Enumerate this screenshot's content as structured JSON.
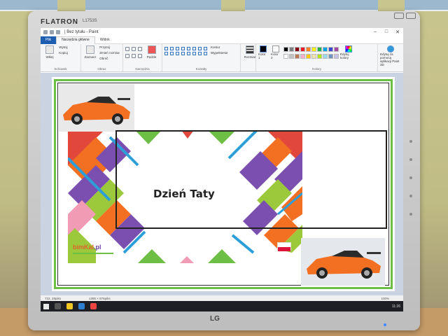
{
  "monitor": {
    "brand": "FLATRON",
    "model": "L1753S",
    "logo": "LG"
  },
  "paint": {
    "window_title": "| Bez tytułu - Paint",
    "tabs": [
      {
        "label": "Plik"
      },
      {
        "label": "Narzędzia główne"
      },
      {
        "label": "Widok"
      }
    ],
    "groups": {
      "clipboard": {
        "name": "Schowek",
        "paste": "Wklej",
        "cut": "Wytnij",
        "copy": "Kopiuj"
      },
      "image": {
        "name": "Obraz",
        "select": "Zaznacz",
        "crop": "Przytnij",
        "resize": "Zmień rozmiar",
        "rotate": "Obróć"
      },
      "tools": {
        "name": "Narzędzia"
      },
      "brushes": {
        "label": "Pędzle"
      },
      "shapes": {
        "name": "Kształty",
        "outline": "Kontur",
        "fill": "Wypełnienie"
      },
      "size": {
        "label": "Rozmiar"
      },
      "colors": {
        "name": "Kolory",
        "color1": "Kolor 1",
        "color2": "Kolor 2",
        "edit": "Edytuj kolory",
        "paint3d": "Edytuj za pomocą aplikacji Paint 3D"
      }
    },
    "palette": [
      "#000000",
      "#7f7f7f",
      "#880015",
      "#ed1c24",
      "#ff7f27",
      "#fff200",
      "#22b14c",
      "#00a2e8",
      "#3f48cc",
      "#a349a4",
      "#ffffff",
      "#c3c3c3",
      "#b97a57",
      "#ffaec9",
      "#ffc90e",
      "#efe4b0",
      "#b5e61d",
      "#99d9ea",
      "#7092be",
      "#c8bfe7"
    ],
    "status": {
      "pos": "722, 28piks",
      "size": "1395 × 876piks",
      "zoom": "100%"
    }
  },
  "card": {
    "greeting": "Dzień Taty",
    "brand_part1": "bimKal",
    "brand_part2": ".pl"
  },
  "taskbar": {
    "time": "11:26"
  },
  "colors": {
    "frame_green": "#6cbe45",
    "orange": "#f36f21",
    "purple": "#7a4fb0",
    "red": "#e2473b",
    "blue": "#2c9fd9",
    "lime": "#9cc93b",
    "pink": "#f29bb5"
  }
}
